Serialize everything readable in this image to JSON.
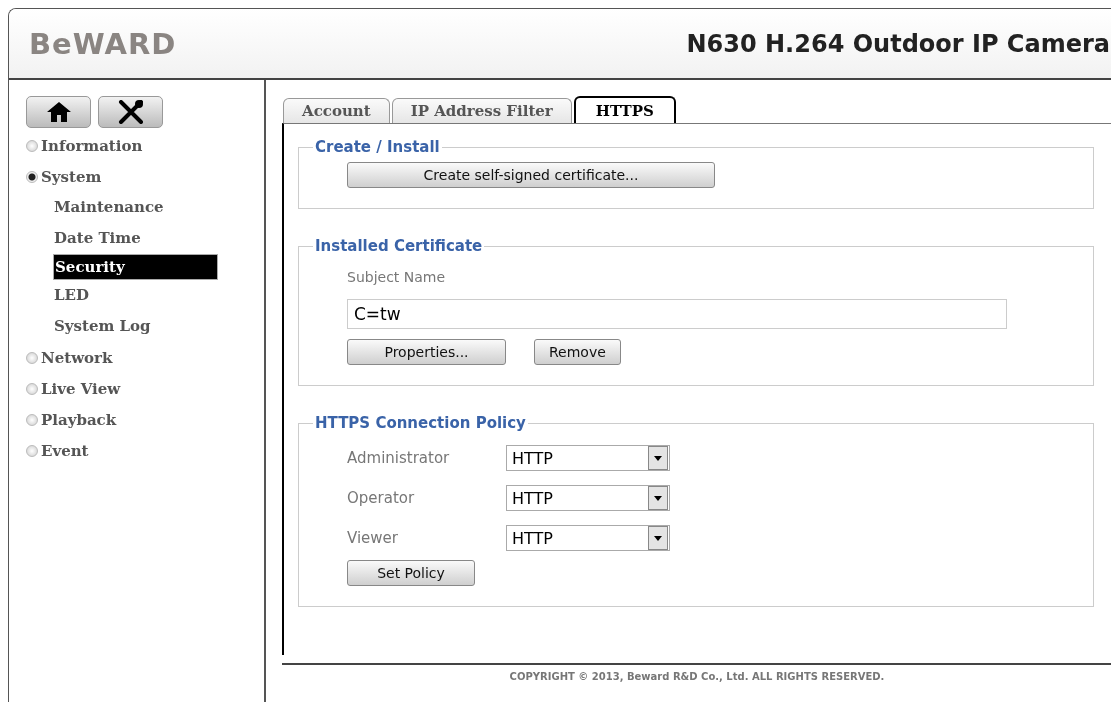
{
  "header": {
    "logo": "BeWARD",
    "title": "N630 H.264 Outdoor IP Camera"
  },
  "sidebar": {
    "items": [
      {
        "label": "Information",
        "expanded": false
      },
      {
        "label": "System",
        "expanded": true,
        "children": [
          {
            "label": "Maintenance",
            "selected": false
          },
          {
            "label": "Date Time",
            "selected": false
          },
          {
            "label": "Security",
            "selected": true
          },
          {
            "label": "LED",
            "selected": false
          },
          {
            "label": "System Log",
            "selected": false
          }
        ]
      },
      {
        "label": "Network",
        "expanded": false
      },
      {
        "label": "Live View",
        "expanded": false
      },
      {
        "label": "Playback",
        "expanded": false
      },
      {
        "label": "Event",
        "expanded": false
      }
    ]
  },
  "tabs": [
    {
      "label": "Account",
      "selected": false
    },
    {
      "label": "IP Address Filter",
      "selected": false
    },
    {
      "label": "HTTPS",
      "selected": true
    }
  ],
  "create_install": {
    "legend": "Create / Install",
    "button": "Create self-signed certificate..."
  },
  "installed_certificate": {
    "legend": "Installed Certificate",
    "subject_label": "Subject Name",
    "subject_value": "C=tw",
    "buttons": [
      "Properties...",
      "Remove"
    ]
  },
  "policy": {
    "legend": "HTTPS Connection Policy",
    "rows": [
      {
        "label": "Administrator",
        "value": "HTTP"
      },
      {
        "label": "Operator",
        "value": "HTTP"
      },
      {
        "label": "Viewer",
        "value": "HTTP"
      }
    ],
    "button": "Set Policy"
  },
  "footer": "COPYRIGHT © 2013, Beward R&D Co., Ltd. ALL RIGHTS RESERVED."
}
